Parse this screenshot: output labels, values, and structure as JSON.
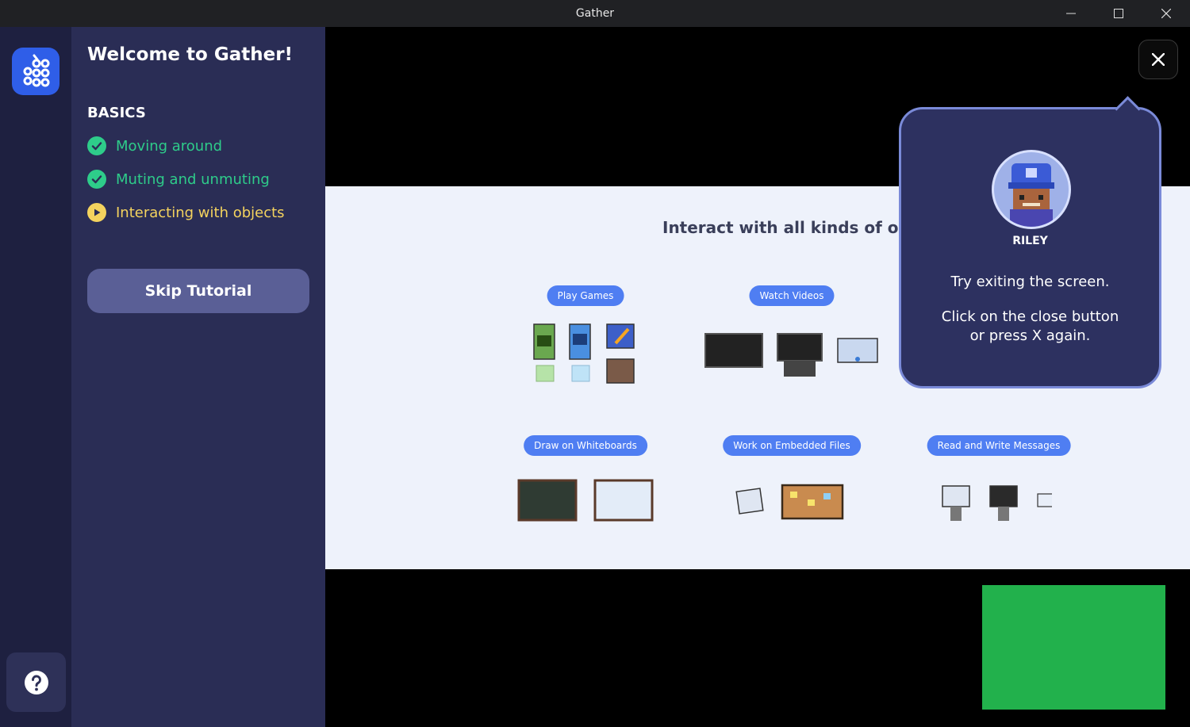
{
  "window": {
    "title": "Gather"
  },
  "sidebar": {
    "welcome_title": "Welcome to Gather!",
    "section_title": "BASICS",
    "steps": [
      {
        "label": "Moving around",
        "status": "done"
      },
      {
        "label": "Muting and unmuting",
        "status": "done"
      },
      {
        "label": "Interacting with objects",
        "status": "current"
      }
    ],
    "skip_label": "Skip Tutorial",
    "help_icon": "question-icon"
  },
  "slide": {
    "heading": "Interact with all kinds of objec",
    "categories": [
      "Play Games",
      "Watch Videos",
      "Draw on Whiteboards",
      "Work on Embedded Files",
      "Read and Write Messages"
    ]
  },
  "tooltip": {
    "name": "RILEY",
    "line1": "Try exiting the screen.",
    "line2": "Click on the close button or press X again."
  },
  "colors": {
    "done": "#2ecc8a",
    "current": "#f4d35e",
    "accent": "#4f7ef2",
    "video": "#22b14c"
  }
}
